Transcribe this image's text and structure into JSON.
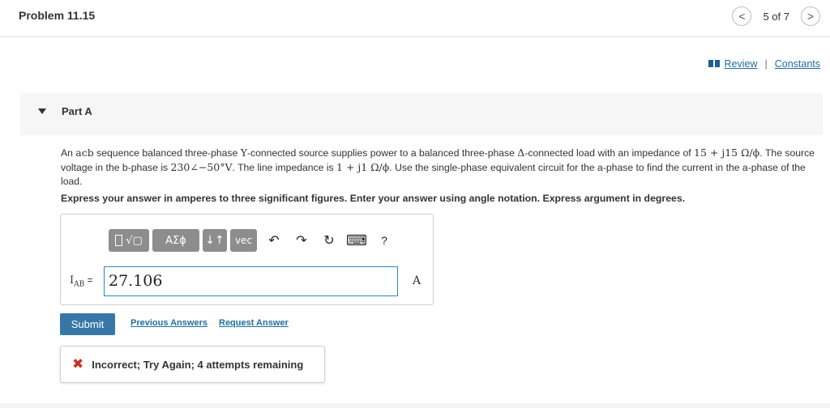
{
  "header": {
    "title": "Problem 11.15",
    "pager_text": "5 of 7",
    "prev_glyph": "<",
    "next_glyph": ">"
  },
  "links": {
    "review": "Review",
    "separator": "|",
    "constants": "Constants"
  },
  "part": {
    "label": "Part A"
  },
  "problem": {
    "t1": "An ",
    "m1": "acb",
    "t2": " sequence balanced three-phase ",
    "m2": "Y",
    "t3": "-connected source supplies power to a balanced three-phase ",
    "m3": "Δ",
    "t4": "-connected load with an impedance of ",
    "m4": "15 + j15 Ω/ϕ",
    "t5": ". The source voltage in the b-phase is ",
    "m5": "230∠−50°V",
    "t6": ". The line impedance is ",
    "m6": "1 + j1 Ω/ϕ",
    "t7": ". Use the single-phase equivalent circuit for the a-phase to find the current in the a-phase of the load.",
    "instructions": "Express your answer in amperes to three significant figures. Enter your answer using angle notation. Express argument in degrees."
  },
  "toolbar": {
    "templates_glyph": "√▢",
    "greek": "ΑΣϕ",
    "arrows": "↓↑",
    "vec": "vec",
    "undo": "↶",
    "redo": "↷",
    "reset": "↻",
    "keyboard": "⌨",
    "help": "?"
  },
  "answer": {
    "label_main": "I",
    "label_sub": "AB",
    "equals": " = ",
    "value": "27.106",
    "unit": "A"
  },
  "actions": {
    "submit": "Submit",
    "previous_answers": "Previous Answers",
    "request_answer": "Request Answer"
  },
  "feedback": {
    "icon": "✖",
    "text": "Incorrect; Try Again; 4 attempts remaining"
  },
  "colors": {
    "accent": "#3777a7",
    "link": "#1f6f9e",
    "error": "#c9302c",
    "toolbar": "#8d8d8d"
  }
}
